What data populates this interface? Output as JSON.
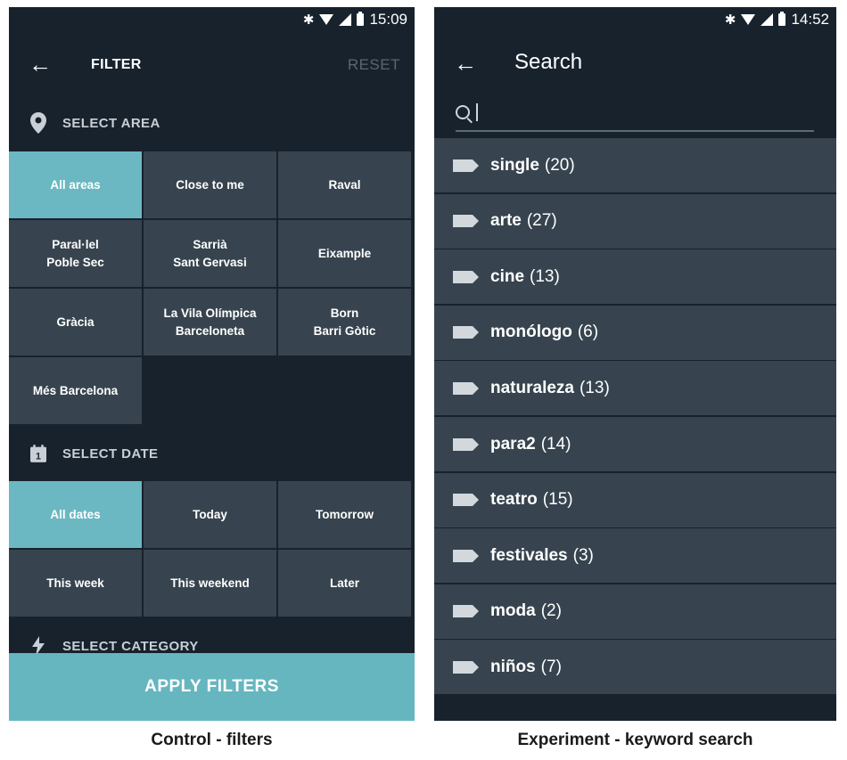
{
  "left_screen": {
    "status": {
      "time": "15:09"
    },
    "header": {
      "title": "FILTER",
      "reset_label": "RESET"
    },
    "area_section": {
      "title": "SELECT AREA"
    },
    "areas": [
      {
        "label": "All areas",
        "selected": true
      },
      {
        "label": "Close to me",
        "selected": false
      },
      {
        "label": "Raval",
        "selected": false
      },
      {
        "label": "Paral·lel\nPoble Sec",
        "selected": false
      },
      {
        "label": "Sarrià\nSant Gervasi",
        "selected": false
      },
      {
        "label": "Eixample",
        "selected": false
      },
      {
        "label": "Gràcia",
        "selected": false
      },
      {
        "label": "La Vila Olímpica\nBarceloneta",
        "selected": false
      },
      {
        "label": "Born\nBarri Gòtic",
        "selected": false
      },
      {
        "label": "Més Barcelona",
        "selected": false
      }
    ],
    "date_section": {
      "title": "SELECT DATE",
      "icon_number": "1"
    },
    "dates": [
      {
        "label": "All dates",
        "selected": true
      },
      {
        "label": "Today",
        "selected": false
      },
      {
        "label": "Tomorrow",
        "selected": false
      },
      {
        "label": "This week",
        "selected": false
      },
      {
        "label": "This weekend",
        "selected": false
      },
      {
        "label": "Later",
        "selected": false
      }
    ],
    "category_section": {
      "title": "SELECT CATEGORY"
    },
    "apply_label": "APPLY FILTERS"
  },
  "right_screen": {
    "status": {
      "time": "14:52"
    },
    "header": {
      "title": "Search"
    },
    "search": {
      "value": ""
    },
    "keywords": [
      {
        "name": "single",
        "count": "(20)"
      },
      {
        "name": "arte",
        "count": "(27)"
      },
      {
        "name": "cine",
        "count": "(13)"
      },
      {
        "name": "monólogo",
        "count": "(6)"
      },
      {
        "name": "naturaleza",
        "count": "(13)"
      },
      {
        "name": "para2",
        "count": "(14)"
      },
      {
        "name": "teatro",
        "count": "(15)"
      },
      {
        "name": "festivales",
        "count": "(3)"
      },
      {
        "name": "moda",
        "count": "(2)"
      },
      {
        "name": "niños",
        "count": "(7)"
      }
    ]
  },
  "captions": {
    "left": "Control - filters",
    "right": "Experiment - keyword search"
  },
  "colors": {
    "background": "#17222d",
    "tile": "#37444f",
    "selected_tile": "#6bb8c2",
    "apply_button": "#66b6bf"
  }
}
